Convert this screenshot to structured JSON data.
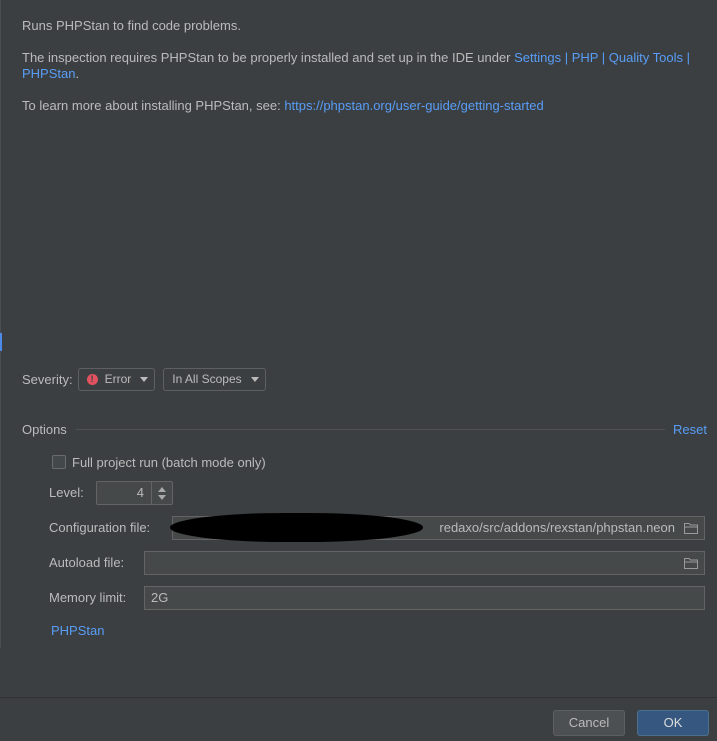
{
  "description": {
    "line1": "Runs PHPStan to find code problems.",
    "requires_text": "The inspection requires PHPStan to be properly installed and set up in the IDE under ",
    "settings_link": "Settings | PHP | Quality Tools | PHPStan",
    "requires_end": ".",
    "learn_text": "To learn more about installing PHPStan, see: ",
    "learn_link": "https://phpstan.org/user-guide/getting-started"
  },
  "severity": {
    "label": "Severity:",
    "value": "Error",
    "scope": "In All Scopes"
  },
  "options": {
    "title": "Options",
    "reset": "Reset",
    "full_project_run": {
      "label": "Full project run (batch mode only)",
      "checked": false
    },
    "level": {
      "label": "Level:",
      "value": "4"
    },
    "config_file": {
      "label": "Configuration file:",
      "value": "redaxo/src/addons/rexstan/phpstan.neon"
    },
    "autoload_file": {
      "label": "Autoload file:",
      "value": ""
    },
    "memory_limit": {
      "label": "Memory limit:",
      "value": "2G"
    },
    "phpstan_link": "PHPStan"
  },
  "buttons": {
    "cancel": "Cancel",
    "ok": "OK"
  },
  "colors": {
    "background": "#3c3f41",
    "link": "#589df6",
    "error": "#e0525f",
    "ok_button": "#365880"
  },
  "icons": {
    "severity": "error-circle-icon",
    "dropdown": "chevron-down-icon",
    "browse": "folder-icon"
  }
}
